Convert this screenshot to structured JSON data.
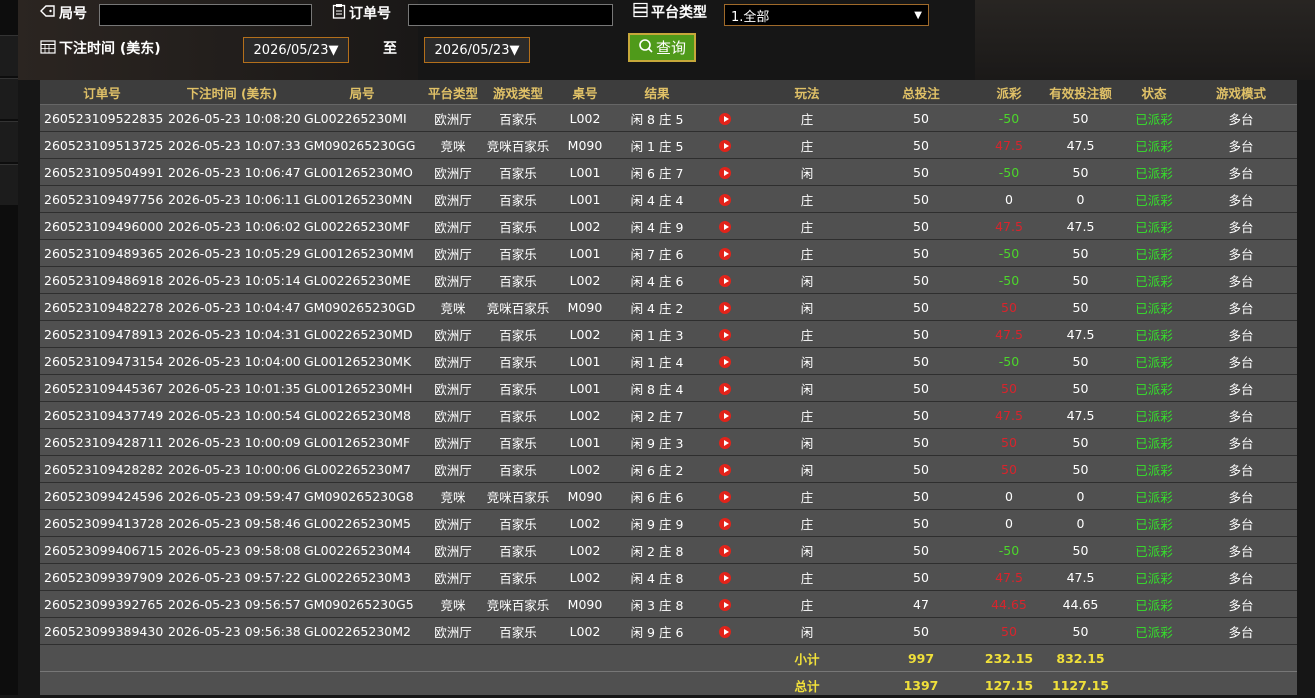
{
  "filters": {
    "round_label": "局号",
    "round_value": "",
    "order_label": "订单号",
    "order_value": "",
    "platform_label": "平台类型",
    "platform_selected": "1.全部",
    "time_label": "下注时间 (美东)",
    "date_from": "2026/05/23▼",
    "to_label": "至",
    "date_to": "2026/05/23▼",
    "query_label": "查询"
  },
  "table": {
    "headers": [
      "订单号",
      "下注时间 (美东)",
      "局号",
      "平台类型",
      "游戏类型",
      "桌号",
      "结果",
      "",
      "玩法",
      "总投注",
      "派彩",
      "有效投注额",
      "状态",
      "游戏模式"
    ],
    "rows": [
      {
        "order": "260523109522835",
        "time": "2026-05-23 10:08:20",
        "round": "GL002265230MI",
        "platform": "欧洲厅",
        "game": "百家乐",
        "table": "L002",
        "result": "闲 8 庄 5",
        "play": "庄",
        "bet": "50",
        "payout": "-50",
        "payout_type": "pos",
        "valid": "50",
        "status": "已派彩",
        "mode": "多台"
      },
      {
        "order": "260523109513725",
        "time": "2026-05-23 10:07:33",
        "round": "GM090265230GG",
        "platform": "竞咪",
        "game": "竞咪百家乐",
        "table": "M090",
        "result": "闲 1 庄 5",
        "play": "庄",
        "bet": "50",
        "payout": "47.5",
        "payout_type": "neg",
        "valid": "47.5",
        "status": "已派彩",
        "mode": "多台"
      },
      {
        "order": "260523109504991",
        "time": "2026-05-23 10:06:47",
        "round": "GL001265230MO",
        "platform": "欧洲厅",
        "game": "百家乐",
        "table": "L001",
        "result": "闲 6 庄 7",
        "play": "闲",
        "bet": "50",
        "payout": "-50",
        "payout_type": "pos",
        "valid": "50",
        "status": "已派彩",
        "mode": "多台"
      },
      {
        "order": "260523109497756",
        "time": "2026-05-23 10:06:11",
        "round": "GL001265230MN",
        "platform": "欧洲厅",
        "game": "百家乐",
        "table": "L001",
        "result": "闲 4 庄 4",
        "play": "庄",
        "bet": "50",
        "payout": "0",
        "payout_type": "zero",
        "valid": "0",
        "status": "已派彩",
        "mode": "多台"
      },
      {
        "order": "260523109496000",
        "time": "2026-05-23 10:06:02",
        "round": "GL002265230MF",
        "platform": "欧洲厅",
        "game": "百家乐",
        "table": "L002",
        "result": "闲 4 庄 9",
        "play": "庄",
        "bet": "50",
        "payout": "47.5",
        "payout_type": "neg",
        "valid": "47.5",
        "status": "已派彩",
        "mode": "多台"
      },
      {
        "order": "260523109489365",
        "time": "2026-05-23 10:05:29",
        "round": "GL001265230MM",
        "platform": "欧洲厅",
        "game": "百家乐",
        "table": "L001",
        "result": "闲 7 庄 6",
        "play": "庄",
        "bet": "50",
        "payout": "-50",
        "payout_type": "pos",
        "valid": "50",
        "status": "已派彩",
        "mode": "多台"
      },
      {
        "order": "260523109486918",
        "time": "2026-05-23 10:05:14",
        "round": "GL002265230ME",
        "platform": "欧洲厅",
        "game": "百家乐",
        "table": "L002",
        "result": "闲 4 庄 6",
        "play": "闲",
        "bet": "50",
        "payout": "-50",
        "payout_type": "pos",
        "valid": "50",
        "status": "已派彩",
        "mode": "多台"
      },
      {
        "order": "260523109482278",
        "time": "2026-05-23 10:04:47",
        "round": "GM090265230GD",
        "platform": "竞咪",
        "game": "竞咪百家乐",
        "table": "M090",
        "result": "闲 4 庄 2",
        "play": "闲",
        "bet": "50",
        "payout": "50",
        "payout_type": "neg",
        "valid": "50",
        "status": "已派彩",
        "mode": "多台"
      },
      {
        "order": "260523109478913",
        "time": "2026-05-23 10:04:31",
        "round": "GL002265230MD",
        "platform": "欧洲厅",
        "game": "百家乐",
        "table": "L002",
        "result": "闲 1 庄 3",
        "play": "庄",
        "bet": "50",
        "payout": "47.5",
        "payout_type": "neg",
        "valid": "47.5",
        "status": "已派彩",
        "mode": "多台"
      },
      {
        "order": "260523109473154",
        "time": "2026-05-23 10:04:00",
        "round": "GL001265230MK",
        "platform": "欧洲厅",
        "game": "百家乐",
        "table": "L001",
        "result": "闲 1 庄 4",
        "play": "闲",
        "bet": "50",
        "payout": "-50",
        "payout_type": "pos",
        "valid": "50",
        "status": "已派彩",
        "mode": "多台"
      },
      {
        "order": "260523109445367",
        "time": "2026-05-23 10:01:35",
        "round": "GL001265230MH",
        "platform": "欧洲厅",
        "game": "百家乐",
        "table": "L001",
        "result": "闲 8 庄 4",
        "play": "闲",
        "bet": "50",
        "payout": "50",
        "payout_type": "neg",
        "valid": "50",
        "status": "已派彩",
        "mode": "多台"
      },
      {
        "order": "260523109437749",
        "time": "2026-05-23 10:00:54",
        "round": "GL002265230M8",
        "platform": "欧洲厅",
        "game": "百家乐",
        "table": "L002",
        "result": "闲 2 庄 7",
        "play": "庄",
        "bet": "50",
        "payout": "47.5",
        "payout_type": "neg",
        "valid": "47.5",
        "status": "已派彩",
        "mode": "多台"
      },
      {
        "order": "260523109428711",
        "time": "2026-05-23 10:00:09",
        "round": "GL001265230MF",
        "platform": "欧洲厅",
        "game": "百家乐",
        "table": "L001",
        "result": "闲 9 庄 3",
        "play": "闲",
        "bet": "50",
        "payout": "50",
        "payout_type": "neg",
        "valid": "50",
        "status": "已派彩",
        "mode": "多台"
      },
      {
        "order": "260523109428282",
        "time": "2026-05-23 10:00:06",
        "round": "GL002265230M7",
        "platform": "欧洲厅",
        "game": "百家乐",
        "table": "L002",
        "result": "闲 6 庄 2",
        "play": "闲",
        "bet": "50",
        "payout": "50",
        "payout_type": "neg",
        "valid": "50",
        "status": "已派彩",
        "mode": "多台"
      },
      {
        "order": "260523099424596",
        "time": "2026-05-23 09:59:47",
        "round": "GM090265230G8",
        "platform": "竞咪",
        "game": "竞咪百家乐",
        "table": "M090",
        "result": "闲 6 庄 6",
        "play": "庄",
        "bet": "50",
        "payout": "0",
        "payout_type": "zero",
        "valid": "0",
        "status": "已派彩",
        "mode": "多台"
      },
      {
        "order": "260523099413728",
        "time": "2026-05-23 09:58:46",
        "round": "GL002265230M5",
        "platform": "欧洲厅",
        "game": "百家乐",
        "table": "L002",
        "result": "闲 9 庄 9",
        "play": "庄",
        "bet": "50",
        "payout": "0",
        "payout_type": "zero",
        "valid": "0",
        "status": "已派彩",
        "mode": "多台"
      },
      {
        "order": "260523099406715",
        "time": "2026-05-23 09:58:08",
        "round": "GL002265230M4",
        "platform": "欧洲厅",
        "game": "百家乐",
        "table": "L002",
        "result": "闲 2 庄 8",
        "play": "闲",
        "bet": "50",
        "payout": "-50",
        "payout_type": "pos",
        "valid": "50",
        "status": "已派彩",
        "mode": "多台"
      },
      {
        "order": "260523099397909",
        "time": "2026-05-23 09:57:22",
        "round": "GL002265230M3",
        "platform": "欧洲厅",
        "game": "百家乐",
        "table": "L002",
        "result": "闲 4 庄 8",
        "play": "庄",
        "bet": "50",
        "payout": "47.5",
        "payout_type": "neg",
        "valid": "47.5",
        "status": "已派彩",
        "mode": "多台"
      },
      {
        "order": "260523099392765",
        "time": "2026-05-23 09:56:57",
        "round": "GM090265230G5",
        "platform": "竞咪",
        "game": "竞咪百家乐",
        "table": "M090",
        "result": "闲 3 庄 8",
        "play": "庄",
        "bet": "47",
        "payout": "44.65",
        "payout_type": "neg",
        "valid": "44.65",
        "status": "已派彩",
        "mode": "多台"
      },
      {
        "order": "260523099389430",
        "time": "2026-05-23 09:56:38",
        "round": "GL002265230M2",
        "platform": "欧洲厅",
        "game": "百家乐",
        "table": "L002",
        "result": "闲 9 庄 6",
        "play": "闲",
        "bet": "50",
        "payout": "50",
        "payout_type": "neg",
        "valid": "50",
        "status": "已派彩",
        "mode": "多台"
      }
    ],
    "subtotal": {
      "label": "小计",
      "bet": "997",
      "payout": "232.15",
      "valid": "832.15"
    },
    "total": {
      "label": "总计",
      "bet": "1397",
      "payout": "127.15",
      "valid": "1127.15"
    }
  },
  "colors": {
    "header_text": "#e0c167",
    "positive": "#4cd62b",
    "negative": "#d8242c",
    "status": "#35e02b",
    "totals": "#f0e03a",
    "query_btn": "#4f9a1a"
  },
  "icons": {
    "round": "tag-icon",
    "order": "clipboard-icon",
    "platform": "server-icon",
    "time": "calendar-icon",
    "query": "search-icon",
    "video": "play-icon"
  }
}
